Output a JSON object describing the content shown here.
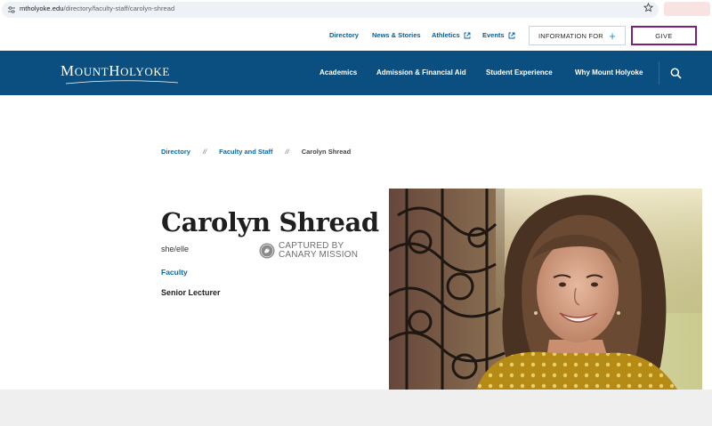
{
  "browser": {
    "url_domain": "mtholyoke.edu",
    "url_path": "/directory/faculty-staff/carolyn-shread"
  },
  "utility_nav": {
    "links": [
      {
        "label": "Directory"
      },
      {
        "label": "News & Stories"
      },
      {
        "label": "Athletics"
      },
      {
        "label": "Events"
      }
    ],
    "info_button": "INFORMATION FOR",
    "give_button": "GIVE"
  },
  "main_nav": {
    "logo": "MOUNT HOLYOKE",
    "items": [
      {
        "label": "Academics"
      },
      {
        "label": "Admission & Financial Aid"
      },
      {
        "label": "Student Experience"
      },
      {
        "label": "Why Mount Holyoke"
      }
    ]
  },
  "breadcrumb": {
    "items": [
      "Directory",
      "Faculty and Staff",
      "Carolyn Shread"
    ],
    "separator": "//"
  },
  "profile": {
    "name": "Carolyn Shread",
    "pronouns": "she/elle",
    "category": "Faculty",
    "title": "Senior Lecturer"
  },
  "stamp": {
    "line1": "CAPTURED BY",
    "line2": "CANARY MISSION"
  },
  "colors": {
    "brand_navy": "#0b4f80",
    "link_blue": "#0a6aa8",
    "give_purple": "#7b1e7a"
  }
}
